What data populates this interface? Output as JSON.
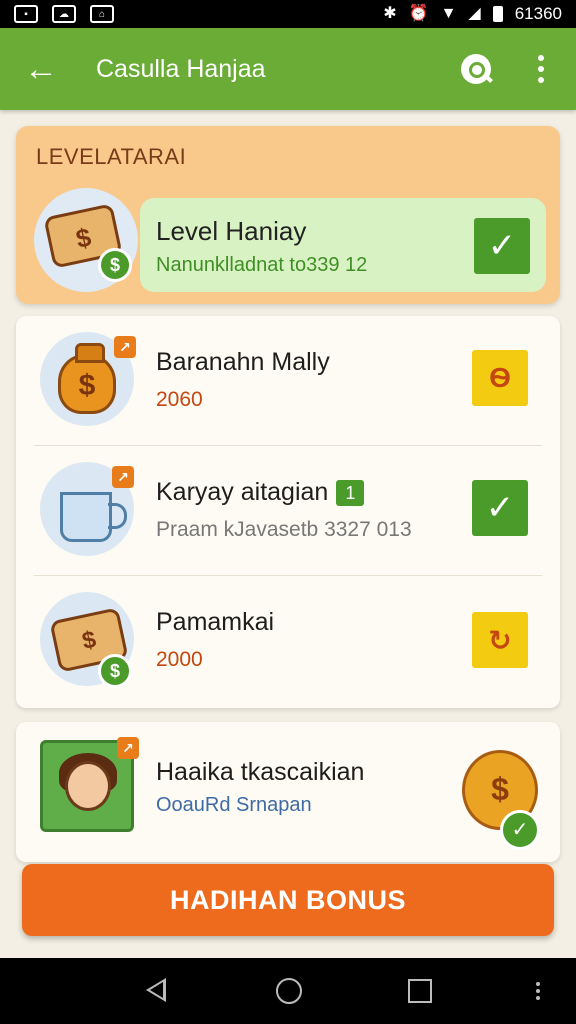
{
  "status_bar": {
    "time": "61360",
    "left_icons": [
      "image-icon",
      "cloud-icon",
      "lock-icon"
    ],
    "right_icons": [
      "bluetooth-icon",
      "alarm-icon",
      "wifi-icon",
      "signal-icon",
      "battery-icon"
    ]
  },
  "app_bar": {
    "title": "Casulla Hanjaa",
    "back_icon": "arrow-left-icon",
    "search_icon": "search-icon",
    "more_icon": "more-vert-icon",
    "color": "#6aac36"
  },
  "level_card": {
    "header": "LEVELATARAI",
    "item": {
      "title": "Level Haniay",
      "subtitle": "Nanunklladnat to339 12",
      "icon": "money-scroll-icon",
      "status_icon": "check-icon"
    },
    "card_color": "#f8c98a",
    "row_color": "#d9f2c4"
  },
  "list": {
    "items": [
      {
        "title": "Baranahn Mally",
        "value": "2060",
        "icon": "money-bag-icon",
        "status_icon": "yellow-badge-icon",
        "status_glyph": "Ѳ"
      },
      {
        "title": "Karyay aitagian",
        "value": "Praam kJavasetb 3327 013",
        "icon": "coin-cup-icon",
        "badge": "1",
        "status_icon": "check-icon"
      },
      {
        "title": "Pamamkai",
        "value": "2000",
        "icon": "money-scroll-icon",
        "status_icon": "yellow-badge-icon",
        "status_glyph": "↻"
      }
    ]
  },
  "promo": {
    "title": "Haaika tkascaikian",
    "subtitle": "OoauRd Srnapan",
    "icon": "avatar-coins-icon",
    "reward_icon": "gold-coin-icon"
  },
  "bonus_button": {
    "label": "HADIHAN BONUS",
    "color": "#ee6a1c"
  },
  "nav_bar": {
    "icons": [
      "nav-back-icon",
      "nav-home-icon",
      "nav-recents-icon",
      "nav-more-icon"
    ]
  }
}
